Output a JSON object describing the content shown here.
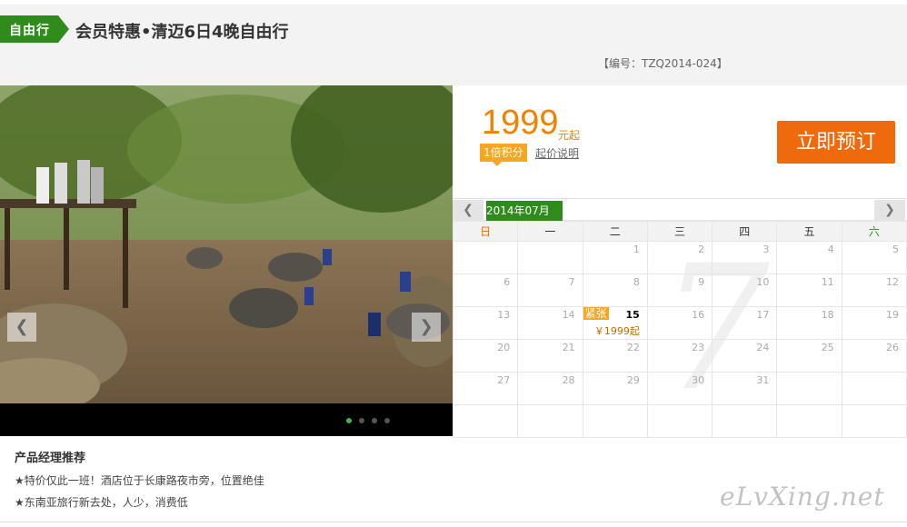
{
  "header": {
    "tag": "自由行",
    "title": "会员特惠•清迈6日4晚自由行",
    "code": "【编号：TZQ2014-024】"
  },
  "gallery": {
    "prev_icon": "chevron-left-icon",
    "next_icon": "chevron-right-icon",
    "slides": 4,
    "active_slide": 1
  },
  "price": {
    "amount": "1999",
    "unit": "元起",
    "points_badge": "1倍积分",
    "note_link": "起价说明",
    "book_button": "立即预订",
    "accent_color": "#f08200"
  },
  "calendar": {
    "month_label": "2014年07月",
    "weekdays": [
      "日",
      "一",
      "二",
      "三",
      "四",
      "五",
      "六"
    ],
    "watermark_digit": "7",
    "weeks": [
      [
        "",
        "",
        "1",
        "2",
        "3",
        "4",
        "5"
      ],
      [
        "6",
        "7",
        "8",
        "9",
        "10",
        "11",
        "12"
      ],
      [
        "13",
        "14",
        "15",
        "16",
        "17",
        "18",
        "19"
      ],
      [
        "20",
        "21",
        "22",
        "23",
        "24",
        "25",
        "26"
      ],
      [
        "27",
        "28",
        "29",
        "30",
        "31",
        "",
        ""
      ],
      [
        "",
        "",
        "",
        "",
        "",
        "",
        ""
      ]
    ],
    "available": {
      "day": "15",
      "badge": "紧张",
      "price": "￥1999起"
    }
  },
  "recommend": {
    "title": "产品经理推荐",
    "items": [
      "★特价仅此一班！酒店位于长康路夜市旁，位置绝佳",
      "★东南亚旅行新去处，人少，消费低"
    ]
  },
  "watermark_text": "eLvXing.net"
}
